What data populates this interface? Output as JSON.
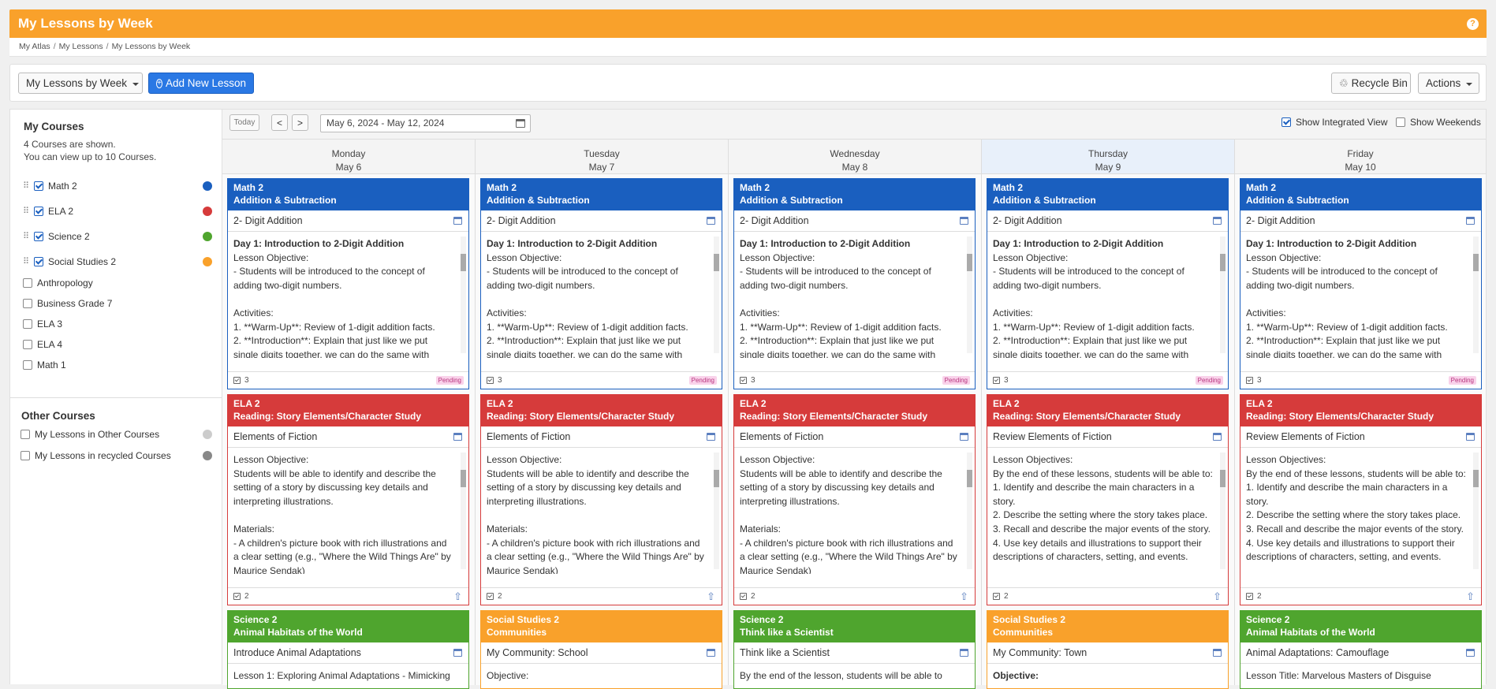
{
  "header": {
    "title": "My Lessons by Week",
    "help_icon": "?"
  },
  "breadcrumb": [
    "My Atlas",
    "My Lessons",
    "My Lessons by Week"
  ],
  "toolbar": {
    "view_select": "My Lessons by Week",
    "add_label": "Add New Lesson",
    "recycle_label": "Recycle Bin",
    "actions_label": "Actions"
  },
  "sidebar": {
    "my_courses_title": "My Courses",
    "shown_note": "4 Courses are shown.",
    "limit_note": "You can view up to 10 Courses.",
    "courses": [
      {
        "name": "Math 2",
        "checked": true,
        "color": "#1a5fbf"
      },
      {
        "name": "ELA 2",
        "checked": true,
        "color": "#d63b3b"
      },
      {
        "name": "Science 2",
        "checked": true,
        "color": "#4fa52e"
      },
      {
        "name": "Social Studies 2",
        "checked": true,
        "color": "#f9a12b"
      },
      {
        "name": "Anthropology",
        "checked": false
      },
      {
        "name": "Business Grade 7",
        "checked": false
      },
      {
        "name": "ELA 3",
        "checked": false
      },
      {
        "name": "ELA 4",
        "checked": false
      },
      {
        "name": "Math 1",
        "checked": false
      }
    ],
    "other_title": "Other Courses",
    "other": [
      {
        "name": "My Lessons in Other Courses",
        "color": "#cccccc"
      },
      {
        "name": "My Lessons in recycled Courses",
        "color": "#888888"
      }
    ]
  },
  "calendar": {
    "today_label": "Today",
    "prev": "<",
    "next": ">",
    "range": "May 6, 2024 - May 12, 2024",
    "integrated_label": "Show Integrated View",
    "weekends_label": "Show Weekends"
  },
  "days": [
    {
      "day": "Monday",
      "date": "May 6"
    },
    {
      "day": "Tuesday",
      "date": "May 7"
    },
    {
      "day": "Wednesday",
      "date": "May 8"
    },
    {
      "day": "Thursday",
      "date": "May 9"
    },
    {
      "day": "Friday",
      "date": "May 10"
    }
  ],
  "math": {
    "course": "Math 2",
    "unit": "Addition & Subtraction",
    "lesson": "2- Digit Addition",
    "body_title": "Day 1: Introduction to 2-Digit Addition",
    "body": "Lesson Objective:\n- Students will be introduced to the concept of adding two-digit numbers.\n\nActivities:\n1. **Warm-Up**: Review of 1-digit addition facts.\n2. **Introduction**: Explain that just like we put single digits together, we can do the same with larger",
    "count": "3",
    "status": "Pending",
    "color": "#1a5fbf"
  },
  "ela_a": {
    "course": "ELA 2",
    "unit": "Reading: Story Elements/Character Study",
    "lesson": "Elements of Fiction",
    "body": "Lesson Objective:\nStudents will be able to identify and describe the setting of a story by discussing key details and interpreting illustrations.\n\nMaterials:\n- A children's picture book with rich illustrations and a clear setting (e.g., \"Where the Wild Things Are\" by Maurice Sendak)",
    "count": "2",
    "color": "#d63b3b"
  },
  "ela_b": {
    "course": "ELA 2",
    "unit": "Reading: Story Elements/Character Study",
    "lesson": "Review Elements of Fiction",
    "body": "Lesson Objectives:\nBy the end of these lessons, students will be able to:\n1. Identify and describe the main characters in a story.\n2. Describe the setting where the story takes place.\n3. Recall and describe the major events of the story.\n4. Use key details and illustrations to support their descriptions of characters, setting, and events.\n\n---",
    "count": "2",
    "color": "#d63b3b"
  },
  "third": [
    {
      "course": "Science 2",
      "unit": "Animal Habitats of the World",
      "lesson": "Introduce Animal Adaptations",
      "body": "Lesson 1: Exploring Animal Adaptations - Mimicking",
      "color": "#4fa52e"
    },
    {
      "course": "Social Studies 2",
      "unit": "Communities",
      "lesson": "My Community: School",
      "body": "Objective:",
      "color": "#f9a12b"
    },
    {
      "course": "Science 2",
      "unit": "Think like a Scientist",
      "lesson": "Think like a Scientist",
      "body": "By the end of the lesson, students will be able to",
      "color": "#4fa52e"
    },
    {
      "course": "Social Studies 2",
      "unit": "Communities",
      "lesson": "My Community: Town",
      "body": "Objective:",
      "color": "#f9a12b"
    },
    {
      "course": "Science 2",
      "unit": "Animal Habitats of the World",
      "lesson": "Animal Adaptations: Camouflage",
      "body": "Lesson Title: Marvelous Masters of Disguise",
      "color": "#4fa52e"
    }
  ]
}
